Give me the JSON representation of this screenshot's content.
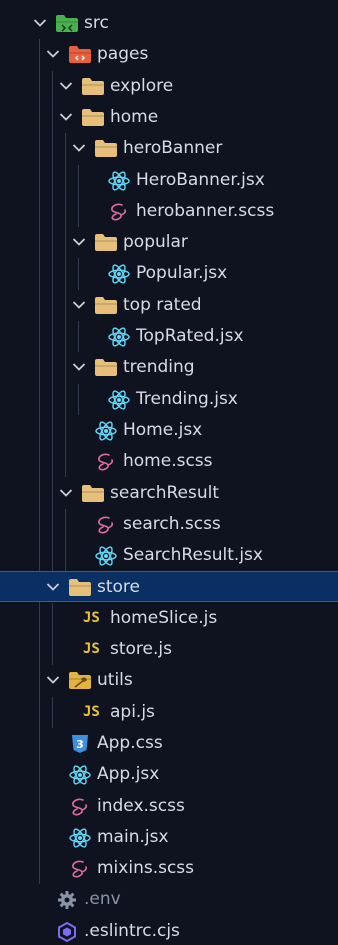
{
  "explorer": {
    "items": [
      {
        "label": "src",
        "icon": "src-folder-icon",
        "depth": 0,
        "chevron": "down"
      },
      {
        "label": "pages",
        "icon": "pages-folder-icon",
        "depth": 1,
        "chevron": "down"
      },
      {
        "label": "explore",
        "icon": "folder-icon",
        "depth": 2,
        "chevron": "down"
      },
      {
        "label": "home",
        "icon": "folder-icon",
        "depth": 2,
        "chevron": "down"
      },
      {
        "label": "heroBanner",
        "icon": "folder-icon",
        "depth": 3,
        "chevron": "down"
      },
      {
        "label": "HeroBanner.jsx",
        "icon": "react-icon",
        "depth": 4
      },
      {
        "label": "herobanner.scss",
        "icon": "sass-icon",
        "depth": 4
      },
      {
        "label": "popular",
        "icon": "folder-icon",
        "depth": 3,
        "chevron": "down"
      },
      {
        "label": "Popular.jsx",
        "icon": "react-icon",
        "depth": 4
      },
      {
        "label": "top rated",
        "icon": "folder-icon",
        "depth": 3,
        "chevron": "down"
      },
      {
        "label": "TopRated.jsx",
        "icon": "react-icon",
        "depth": 4
      },
      {
        "label": "trending",
        "icon": "folder-icon",
        "depth": 3,
        "chevron": "down"
      },
      {
        "label": "Trending.jsx",
        "icon": "react-icon",
        "depth": 4
      },
      {
        "label": "Home.jsx",
        "icon": "react-icon",
        "depth": 3
      },
      {
        "label": "home.scss",
        "icon": "sass-icon",
        "depth": 3
      },
      {
        "label": "searchResult",
        "icon": "folder-icon",
        "depth": 2,
        "chevron": "down"
      },
      {
        "label": "search.scss",
        "icon": "sass-icon",
        "depth": 3
      },
      {
        "label": "SearchResult.jsx",
        "icon": "react-icon",
        "depth": 3
      },
      {
        "label": "store",
        "icon": "folder-icon",
        "depth": 1,
        "chevron": "down",
        "selected": true
      },
      {
        "label": "homeSlice.js",
        "icon": "js-icon",
        "depth": 2
      },
      {
        "label": "store.js",
        "icon": "js-icon",
        "depth": 2
      },
      {
        "label": "utils",
        "icon": "utils-folder-icon",
        "depth": 1,
        "chevron": "down"
      },
      {
        "label": "api.js",
        "icon": "js-icon",
        "depth": 2
      },
      {
        "label": "App.css",
        "icon": "css-icon",
        "depth": 1
      },
      {
        "label": "App.jsx",
        "icon": "react-icon",
        "depth": 1
      },
      {
        "label": "index.scss",
        "icon": "sass-icon",
        "depth": 1
      },
      {
        "label": "main.jsx",
        "icon": "react-icon",
        "depth": 1
      },
      {
        "label": "mixins.scss",
        "icon": "sass-icon",
        "depth": 1
      },
      {
        "label": ".env",
        "icon": "gear-icon",
        "depth": 0,
        "dim": true
      },
      {
        "label": ".eslintrc.cjs",
        "icon": "eslint-icon",
        "depth": 0
      }
    ],
    "js_badge": "JS",
    "css_badge": "3",
    "colors": {
      "background": "#0f1320",
      "selected_row": "#0a2f63",
      "selected_border": "#1d5fbd",
      "folder": "#e6c07b",
      "react": "#61dafb",
      "sass": "#e06c9f",
      "js": "#e8c53c",
      "css": "#3d8fe0",
      "eslint": "#7b6cf0",
      "src_folder": "#4caf50",
      "pages_folder": "#e8613c",
      "utils_folder": "#e2b340"
    }
  }
}
